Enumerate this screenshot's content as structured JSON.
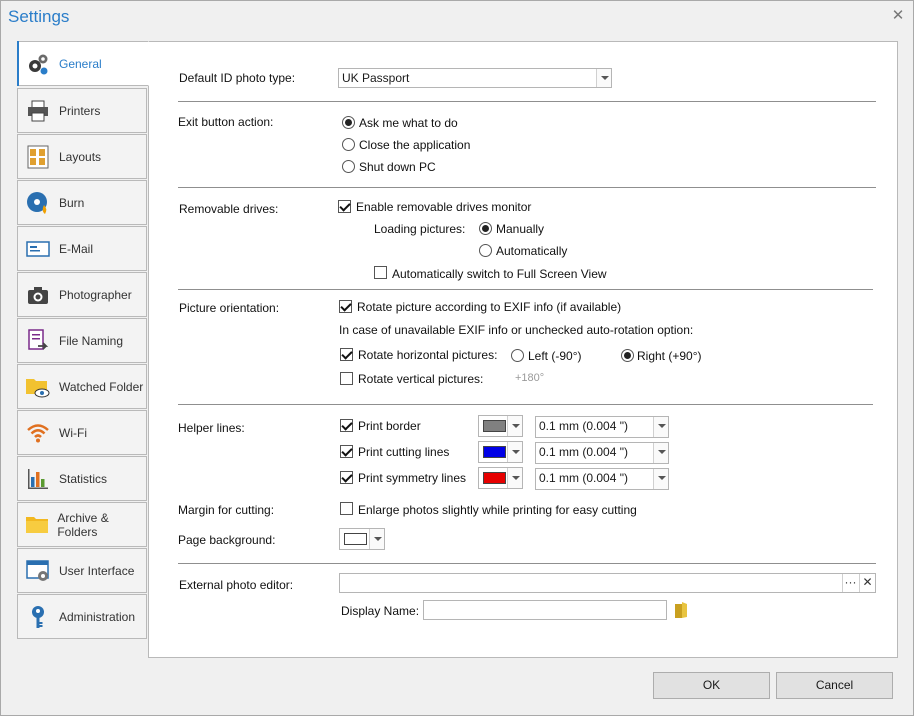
{
  "window": {
    "title": "Settings"
  },
  "tabs": [
    {
      "label": "General",
      "icon": "gears-icon"
    },
    {
      "label": "Printers",
      "icon": "printer-icon"
    },
    {
      "label": "Layouts",
      "icon": "layouts-icon"
    },
    {
      "label": "Burn",
      "icon": "disc-burn-icon"
    },
    {
      "label": "E-Mail",
      "icon": "email-icon"
    },
    {
      "label": "Photographer",
      "icon": "camera-icon"
    },
    {
      "label": "File Naming",
      "icon": "file-naming-icon"
    },
    {
      "label": "Watched Folder",
      "icon": "watched-folder-icon"
    },
    {
      "label": "Wi-Fi",
      "icon": "wifi-icon"
    },
    {
      "label": "Statistics",
      "icon": "statistics-icon"
    },
    {
      "label": "Archive & Folders",
      "icon": "folder-icon"
    },
    {
      "label": "User Interface",
      "icon": "user-interface-icon"
    },
    {
      "label": "Administration",
      "icon": "key-icon"
    }
  ],
  "general": {
    "default_photo_type": {
      "label": "Default ID photo type:",
      "value": "UK Passport"
    },
    "exit_action": {
      "label": "Exit button action:",
      "options": [
        "Ask me what to do",
        "Close the application",
        "Shut down PC"
      ],
      "selected": "Ask me what to do"
    },
    "removable_drives": {
      "label": "Removable drives:",
      "enable_label": "Enable removable drives monitor",
      "enabled": true,
      "loading_label": "Loading pictures:",
      "loading_options": [
        "Manually",
        "Automatically"
      ],
      "loading_selected": "Manually",
      "fullscreen_label": "Automatically switch to Full Screen View",
      "fullscreen": false
    },
    "orientation": {
      "label": "Picture orientation:",
      "rotate_exif_label": "Rotate picture according to EXIF info (if available)",
      "rotate_exif": true,
      "note": "In case of unavailable EXIF info or unchecked auto-rotation option:",
      "horizontal_label": "Rotate horizontal pictures:",
      "horizontal": true,
      "left_label": "Left (-90°)",
      "right_label": "Right (+90°)",
      "direction": "Right (+90°)",
      "vertical_label": "Rotate vertical pictures:",
      "vertical": false,
      "vertical_value": "+180°"
    },
    "helper_lines": {
      "label": "Helper lines:",
      "items": [
        {
          "label": "Print border",
          "checked": true,
          "color": "#808080",
          "width": "0.1 mm (0.004 \")"
        },
        {
          "label": "Print cutting lines",
          "checked": true,
          "color": "#0000e6",
          "width": "0.1 mm (0.004 \")"
        },
        {
          "label": "Print symmetry lines",
          "checked": true,
          "color": "#e60000",
          "width": "0.1 mm (0.004 \")"
        }
      ]
    },
    "margin": {
      "label": "Margin for cutting:",
      "option_label": "Enlarge photos slightly while printing for easy cutting",
      "checked": false
    },
    "background": {
      "label": "Page background:",
      "color": "#ffffff"
    },
    "external_editor": {
      "label": "External photo editor:",
      "value": "",
      "browse_label": "···",
      "clear_label": "✕",
      "display_name_label": "Display Name:",
      "display_name_value": ""
    }
  },
  "footer": {
    "ok_label": "OK",
    "cancel_label": "Cancel"
  },
  "accent_color": "#2a7dc9"
}
